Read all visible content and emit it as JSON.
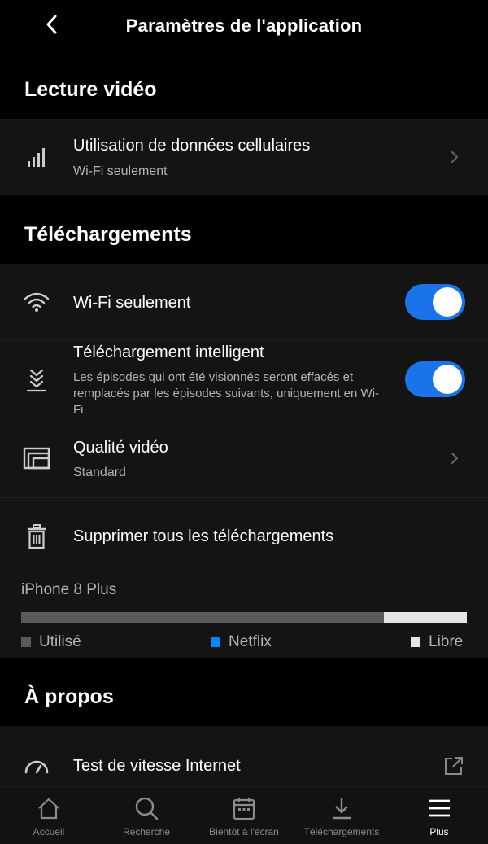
{
  "header": {
    "title": "Paramètres de l'application"
  },
  "sections": {
    "video": "Lecture vidéo",
    "downloads": "Téléchargements",
    "about": "À propos"
  },
  "rows": {
    "cellular": {
      "title": "Utilisation de données cellulaires",
      "subtitle": "Wi-Fi seulement",
      "icon": "signal-bars-icon"
    },
    "wifi_only": {
      "title": "Wi-Fi seulement",
      "icon": "wifi-icon",
      "enabled": true
    },
    "smart_download": {
      "title": "Téléchargement intelligent",
      "description": "Les épisodes qui ont été visionnés seront effacés et remplacés par les épisodes suivants, uniquement en Wi-Fi.",
      "icon": "smart-download-icon",
      "enabled": true
    },
    "video_quality": {
      "title": "Qualité vidéo",
      "subtitle": "Standard",
      "icon": "video-quality-icon"
    },
    "delete_all": {
      "title": "Supprimer tous les téléchargements",
      "icon": "trash-icon"
    },
    "speed_test": {
      "title": "Test de vitesse Internet",
      "icon": "speedometer-icon"
    }
  },
  "storage": {
    "device": "iPhone 8 Plus",
    "used_fraction": 0.814,
    "netflix_fraction": 0.0,
    "legend": {
      "used": "Utilisé",
      "netflix": "Netflix",
      "free": "Libre"
    },
    "colors": {
      "used": "#5a5a5a",
      "netflix": "#0a84ff",
      "free": "#e5e5e5"
    }
  },
  "nav": [
    {
      "label": "Accueil",
      "icon": "home-icon",
      "active": false
    },
    {
      "label": "Recherche",
      "icon": "search-icon",
      "active": false
    },
    {
      "label": "Bientôt à l'écran",
      "icon": "calendar-icon",
      "active": false
    },
    {
      "label": "Téléchargements",
      "icon": "download-icon",
      "active": false
    },
    {
      "label": "Plus",
      "icon": "menu-icon",
      "active": true
    }
  ],
  "colors": {
    "accent": "#1a73e8",
    "background": "#000000",
    "card": "#141414"
  }
}
